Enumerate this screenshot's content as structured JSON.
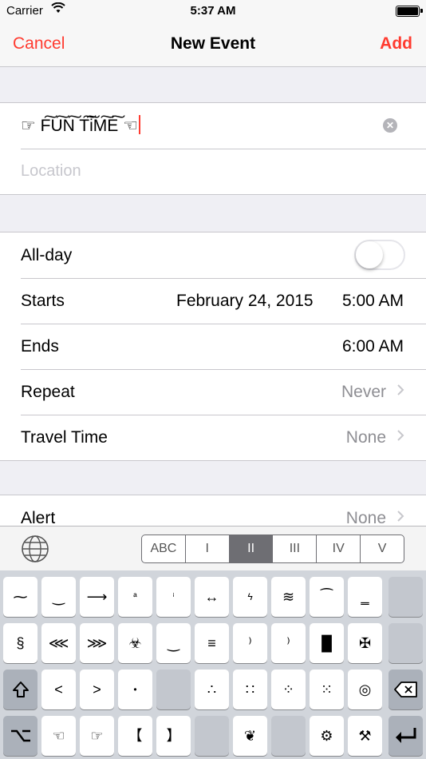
{
  "status_bar": {
    "carrier": "Carrier",
    "time": "5:37 AM"
  },
  "nav": {
    "cancel": "Cancel",
    "title": "New Event",
    "add": "Add"
  },
  "event": {
    "title_value": "☞ F͠U͠N͠ T͠i͠M͠E͠ ☜",
    "location_placeholder": "Location"
  },
  "details": {
    "allday_label": "All-day",
    "allday_on": false,
    "starts_label": "Starts",
    "starts_date": "February 24, 2015",
    "starts_time": "5:00 AM",
    "ends_label": "Ends",
    "ends_time": "6:00 AM",
    "repeat_label": "Repeat",
    "repeat_value": "Never",
    "travel_label": "Travel Time",
    "travel_value": "None"
  },
  "alert": {
    "label": "Alert",
    "value": "None"
  },
  "keyboard": {
    "segments": [
      "ABC",
      "I",
      "II",
      "III",
      "IV",
      "V"
    ],
    "active_segment": "II",
    "row1": [
      "⁓",
      "‿",
      "⟶",
      "ª",
      "ⁱ",
      "↔",
      "ϟ",
      "≋",
      "⁀",
      "‗",
      ""
    ],
    "row2": [
      "§",
      "⋘",
      "⋙",
      "☣",
      "‿",
      "≡",
      "⁾",
      "⁾",
      "█",
      "✠",
      ""
    ],
    "row3": [
      "<",
      ">",
      "•",
      "",
      "∴",
      "∷",
      "⁘",
      "⁙",
      "◎"
    ],
    "row4": [
      "☜",
      "☞",
      "【",
      "】",
      "",
      "❦",
      "",
      "⚙",
      "⚒"
    ]
  }
}
